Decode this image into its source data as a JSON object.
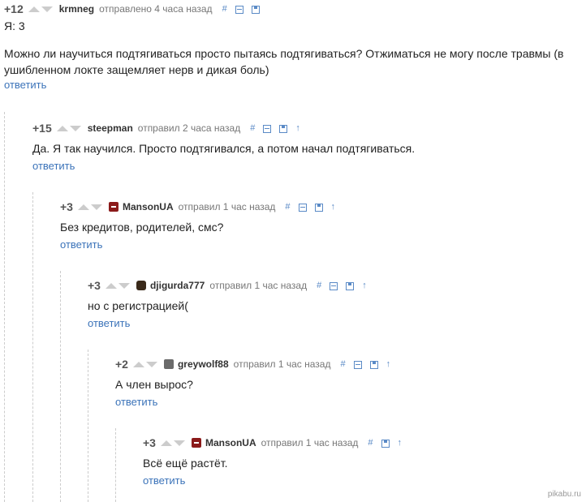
{
  "comments": [
    {
      "rating": "+12",
      "author": "krmneg",
      "meta": "отправлено 4 часа назад",
      "lines": [
        "Я: 3",
        "Можно ли научиться подтягиваться просто пытаясь подтягиваться? Отжиматься не могу после травмы (в",
        "ушибленном локте защемляет нерв и дикая боль)"
      ],
      "reply": "ответить"
    },
    {
      "rating": "+15",
      "author": "steepman",
      "meta": "отправил 2 часа назад",
      "lines": [
        "Да. Я так научился. Просто подтягивался, а потом начал подтягиваться."
      ],
      "reply": "ответить"
    },
    {
      "rating": "+3",
      "author": "MansonUA",
      "meta": "отправил 1 час назад",
      "lines": [
        "Без кредитов, родителей, смс?"
      ],
      "reply": "ответить"
    },
    {
      "rating": "+3",
      "author": "djigurda777",
      "meta": "отправил 1 час назад",
      "lines": [
        "но с регистрацией("
      ],
      "reply": "ответить"
    },
    {
      "rating": "+2",
      "author": "greywolf88",
      "meta": "отправил 1 час назад",
      "lines": [
        "А член вырос?"
      ],
      "reply": "ответить"
    },
    {
      "rating": "+3",
      "author": "MansonUA",
      "meta": "отправил 1 час назад",
      "lines": [
        "Всё ещё растёт."
      ],
      "reply": "ответить"
    }
  ],
  "tools": {
    "link": "#",
    "up": "↑"
  },
  "watermark": "pikabu.ru"
}
